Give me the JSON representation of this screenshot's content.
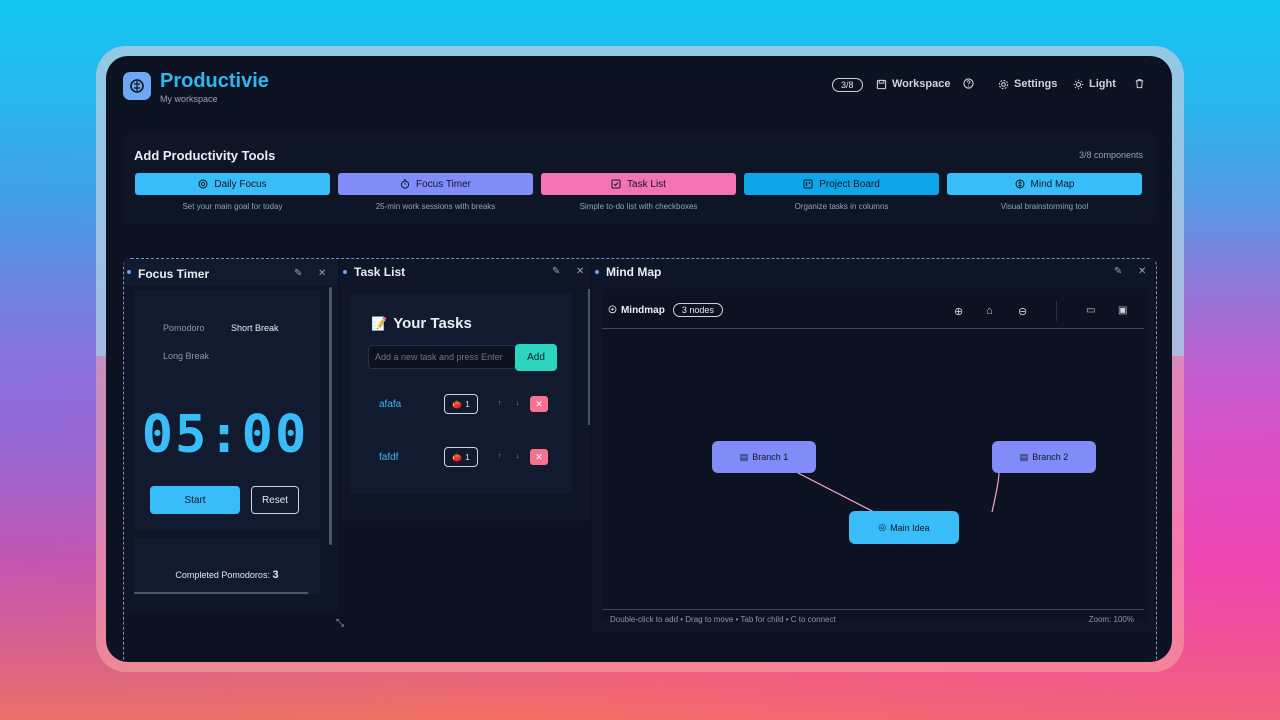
{
  "header": {
    "brand": "Productivie",
    "subtitle": "My workspace",
    "count_badge": "3/8",
    "workspace_label": "Workspace",
    "settings_label": "Settings",
    "theme_label": "Light"
  },
  "tools": {
    "title": "Add Productivity Tools",
    "count": "3/8 components",
    "items": [
      {
        "label": "Daily Focus",
        "desc": "Set your main goal for today",
        "color": "#38bdf8"
      },
      {
        "label": "Focus Timer",
        "desc": "25-min work sessions with breaks",
        "color": "#818cf8"
      },
      {
        "label": "Task List",
        "desc": "Simple to-do list with checkboxes",
        "color": "#f472b6"
      },
      {
        "label": "Project Board",
        "desc": "Organize tasks in columns",
        "color": "#0ea5e9"
      },
      {
        "label": "Mind Map",
        "desc": "Visual brainstorming tool",
        "color": "#38bdf8"
      }
    ]
  },
  "focus_timer": {
    "title": "Focus Timer",
    "modes": [
      "Pomodoro",
      "Short Break",
      "Long Break"
    ],
    "active_mode": "Short Break",
    "time": "05:00",
    "start_label": "Start",
    "reset_label": "Reset",
    "completed_label": "Completed Pomodoros:",
    "completed_count": "3"
  },
  "task_list": {
    "title": "Task List",
    "heading": "Your Tasks",
    "input_placeholder": "Add a new task and press Enter",
    "add_label": "Add",
    "tasks": [
      {
        "name": "afafa",
        "pomodoros": "1",
        "up": "↑",
        "down": "↓"
      },
      {
        "name": "fafdf",
        "pomodoros": "1",
        "up": "↑",
        "down": "↓"
      }
    ]
  },
  "mind_map": {
    "title": "Mind Map",
    "toolbar_label": "Mindmap",
    "node_count": "3 nodes",
    "nodes": [
      {
        "label": "Branch 1",
        "color": "#818cf8"
      },
      {
        "label": "Branch 2",
        "color": "#818cf8"
      },
      {
        "label": "Main Idea",
        "color": "#38bdf8"
      }
    ],
    "edge_color": "#f9a8d4",
    "footer_hint": "Double-click to add • Drag to move • Tab for child • C to connect",
    "zoom": "Zoom: 100%"
  }
}
